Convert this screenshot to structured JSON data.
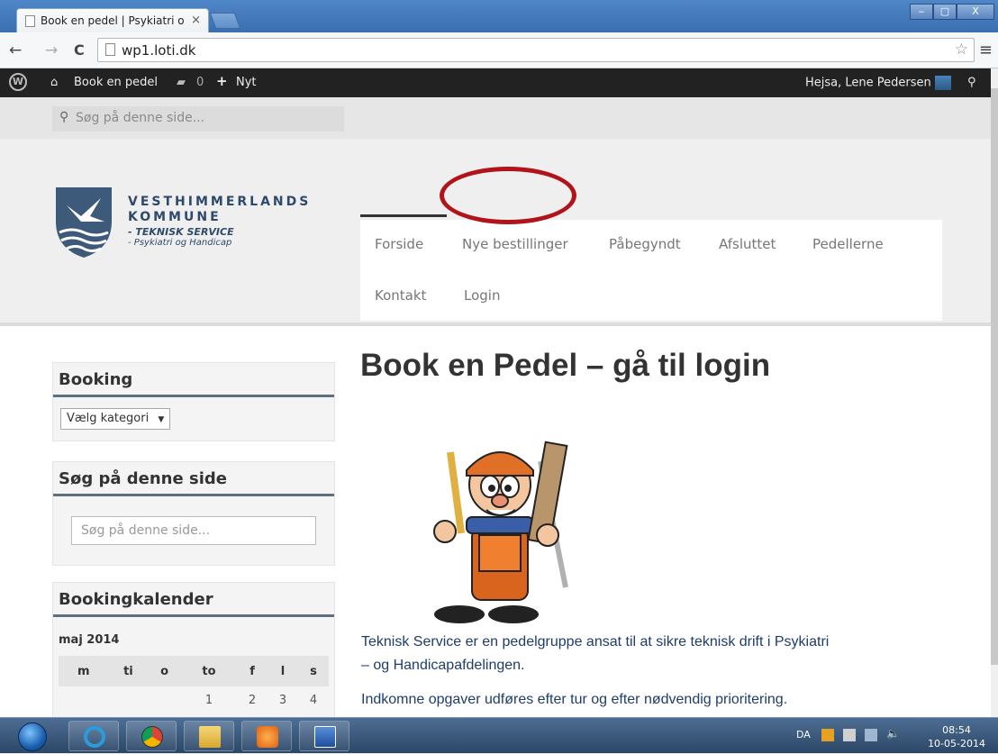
{
  "browser": {
    "tab_title": "Book en pedel | Psykiatri o",
    "tab_close": "×",
    "url": "wp1.loti.dk",
    "back_icon": "←",
    "forward_icon": "→",
    "reload_icon": "C",
    "star_icon": "☆",
    "menu_icon": "≡",
    "window_buttons": [
      "‒",
      "▢",
      "X"
    ]
  },
  "adminbar": {
    "site_name": "Book en pedel",
    "comments_count": "0",
    "new_label": "Nyt",
    "greeting": "Hejsa, Lene Pedersen"
  },
  "site": {
    "search_placeholder": "Søg på denne side...",
    "logo_line1": "VESTHIMMERLANDS",
    "logo_line2": "KOMMUNE",
    "logo_line3": "- TEKNISK SERVICE",
    "logo_line4": "- Psykiatri og Handicap",
    "nav": [
      {
        "label": "Forside"
      },
      {
        "label": "Nye bestillinger"
      },
      {
        "label": "Påbegyndt"
      },
      {
        "label": "Afsluttet"
      },
      {
        "label": "Pedellerne"
      },
      {
        "label": "Kontakt"
      },
      {
        "label": "Login"
      }
    ],
    "annotation_color": "#b0141a"
  },
  "sidebar": {
    "booking_title": "Booking",
    "category_select": "Vælg kategori",
    "search_title": "Søg på denne side",
    "search_placeholder": "Søg på denne side...",
    "calendar_title": "Bookingkalender",
    "calendar_month": "maj 2014",
    "weekdays": [
      "m",
      "ti",
      "o",
      "to",
      "f",
      "l",
      "s"
    ],
    "first_week": [
      "",
      "",
      "",
      "1",
      "2",
      "3",
      "4"
    ]
  },
  "content": {
    "title": "Book en Pedel – gå til login",
    "para1_line1": "Teknisk Service er en pedelgruppe ansat til at sikre teknisk drift i Psykiatri",
    "para1_line2": "– og Handicapafdelingen.",
    "para2": "Indkomne opgaver udføres efter tur og efter nødvendig prioritering."
  },
  "taskbar": {
    "language": "DA",
    "time": "08:54",
    "date": "10-05-2014"
  }
}
